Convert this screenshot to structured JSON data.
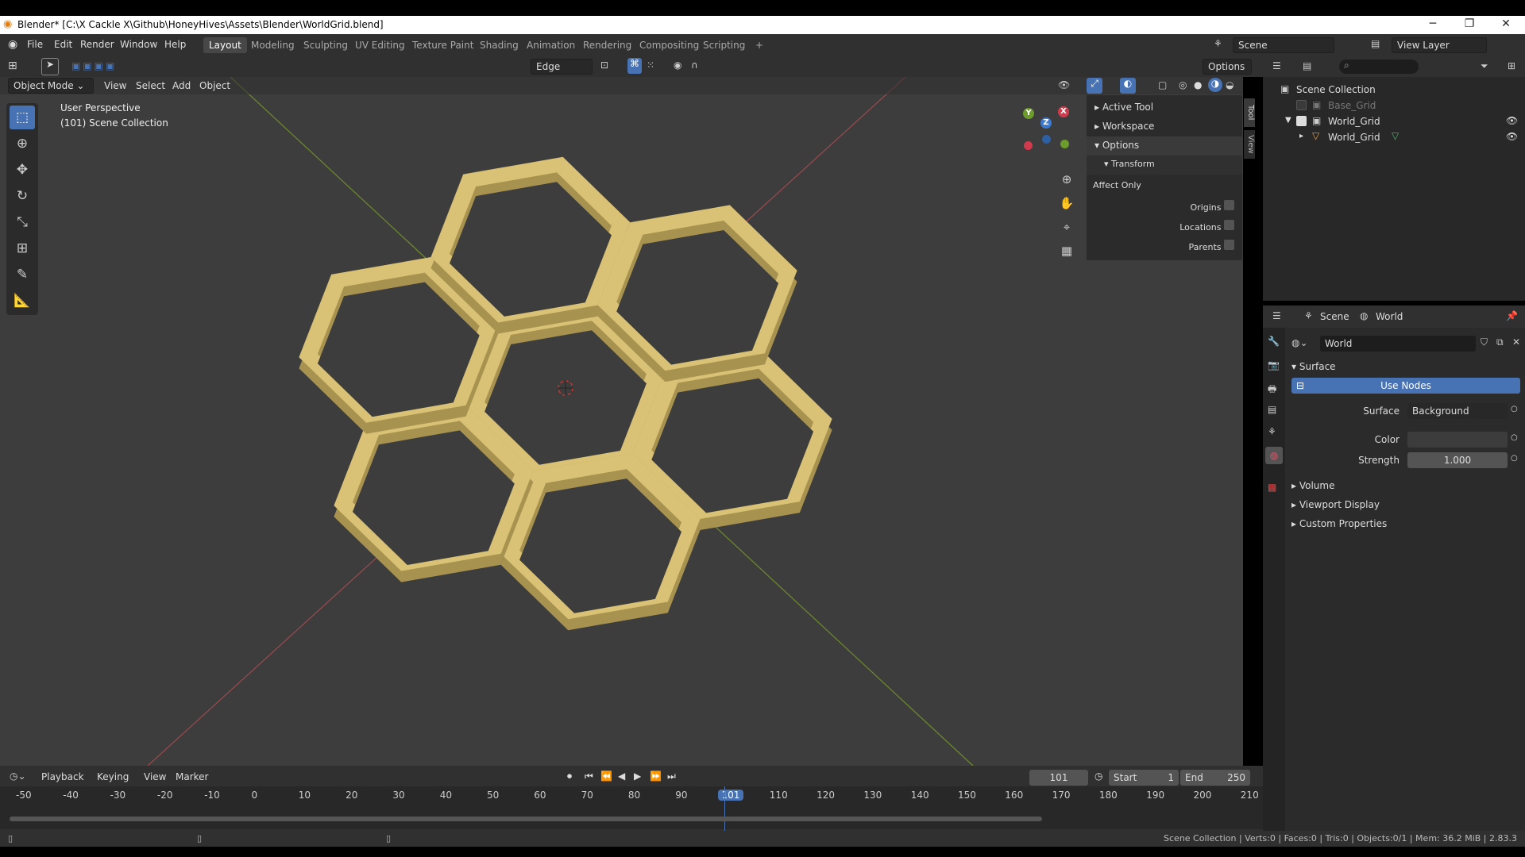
{
  "window": {
    "title": "Blender* [C:\\X Cackle X\\Github\\HoneyHives\\Assets\\Blender\\WorldGrid.blend]",
    "min": "─",
    "max": "❐",
    "close": "✕"
  },
  "menu": [
    "File",
    "Edit",
    "Render",
    "Window",
    "Help"
  ],
  "workspaces": [
    "Layout",
    "Modeling",
    "Sculpting",
    "UV Editing",
    "Texture Paint",
    "Shading",
    "Animation",
    "Rendering",
    "Compositing",
    "Scripting",
    "+"
  ],
  "scene": {
    "name": "Scene",
    "view_layer": "View Layer"
  },
  "tool_header": {
    "select_mode": "Edge",
    "options": "Options"
  },
  "viewport": {
    "mode": "Object Mode",
    "menus": [
      "View",
      "Select",
      "Add",
      "Object"
    ],
    "perspective": "User Perspective",
    "collection": "(101) Scene Collection",
    "gizmo_x": "X",
    "gizmo_y": "Y",
    "gizmo_z": "Z"
  },
  "npanel": {
    "active_tool": "Active Tool",
    "workspace": "Workspace",
    "options": "Options",
    "transform": "Transform",
    "affect_only": "Affect Only",
    "origins": "Origins",
    "locations": "Locations",
    "parents": "Parents",
    "tab_tool": "Tool",
    "tab_view": "View"
  },
  "outliner": {
    "root": "Scene Collection",
    "items": [
      {
        "name": "Base_Grid"
      },
      {
        "name": "World_Grid"
      },
      {
        "name": "World_Grid"
      }
    ]
  },
  "properties": {
    "breadcrumb_scene": "Scene",
    "breadcrumb_world": "World",
    "world_name": "World",
    "surface_section": "Surface",
    "use_nodes": "Use Nodes",
    "surface_label": "Surface",
    "surface_value": "Background",
    "color_label": "Color",
    "strength_label": "Strength",
    "strength_value": "1.000",
    "volume": "Volume",
    "viewport_display": "Viewport Display",
    "custom_properties": "Custom Properties"
  },
  "timeline": {
    "menus": [
      "Playback",
      "Keying",
      "View",
      "Marker"
    ],
    "current_frame": "101",
    "start_label": "Start",
    "start_value": "1",
    "end_label": "End",
    "end_value": "250",
    "ticks": [
      "-50",
      "-40",
      "-30",
      "-20",
      "-10",
      "0",
      "10",
      "20",
      "30",
      "40",
      "50",
      "60",
      "70",
      "80",
      "90",
      "101",
      "110",
      "120",
      "130",
      "140",
      "150",
      "160",
      "170",
      "180",
      "190",
      "200",
      "210"
    ]
  },
  "status": {
    "text": "Scene Collection | Verts:0 | Faces:0 | Tris:0 | Objects:0/1 | Mem: 36.2 MiB | 2.83.3"
  },
  "colors": {
    "hex_top": "#d9c275",
    "hex_side": "#a8924f",
    "accent": "#4772b3"
  }
}
